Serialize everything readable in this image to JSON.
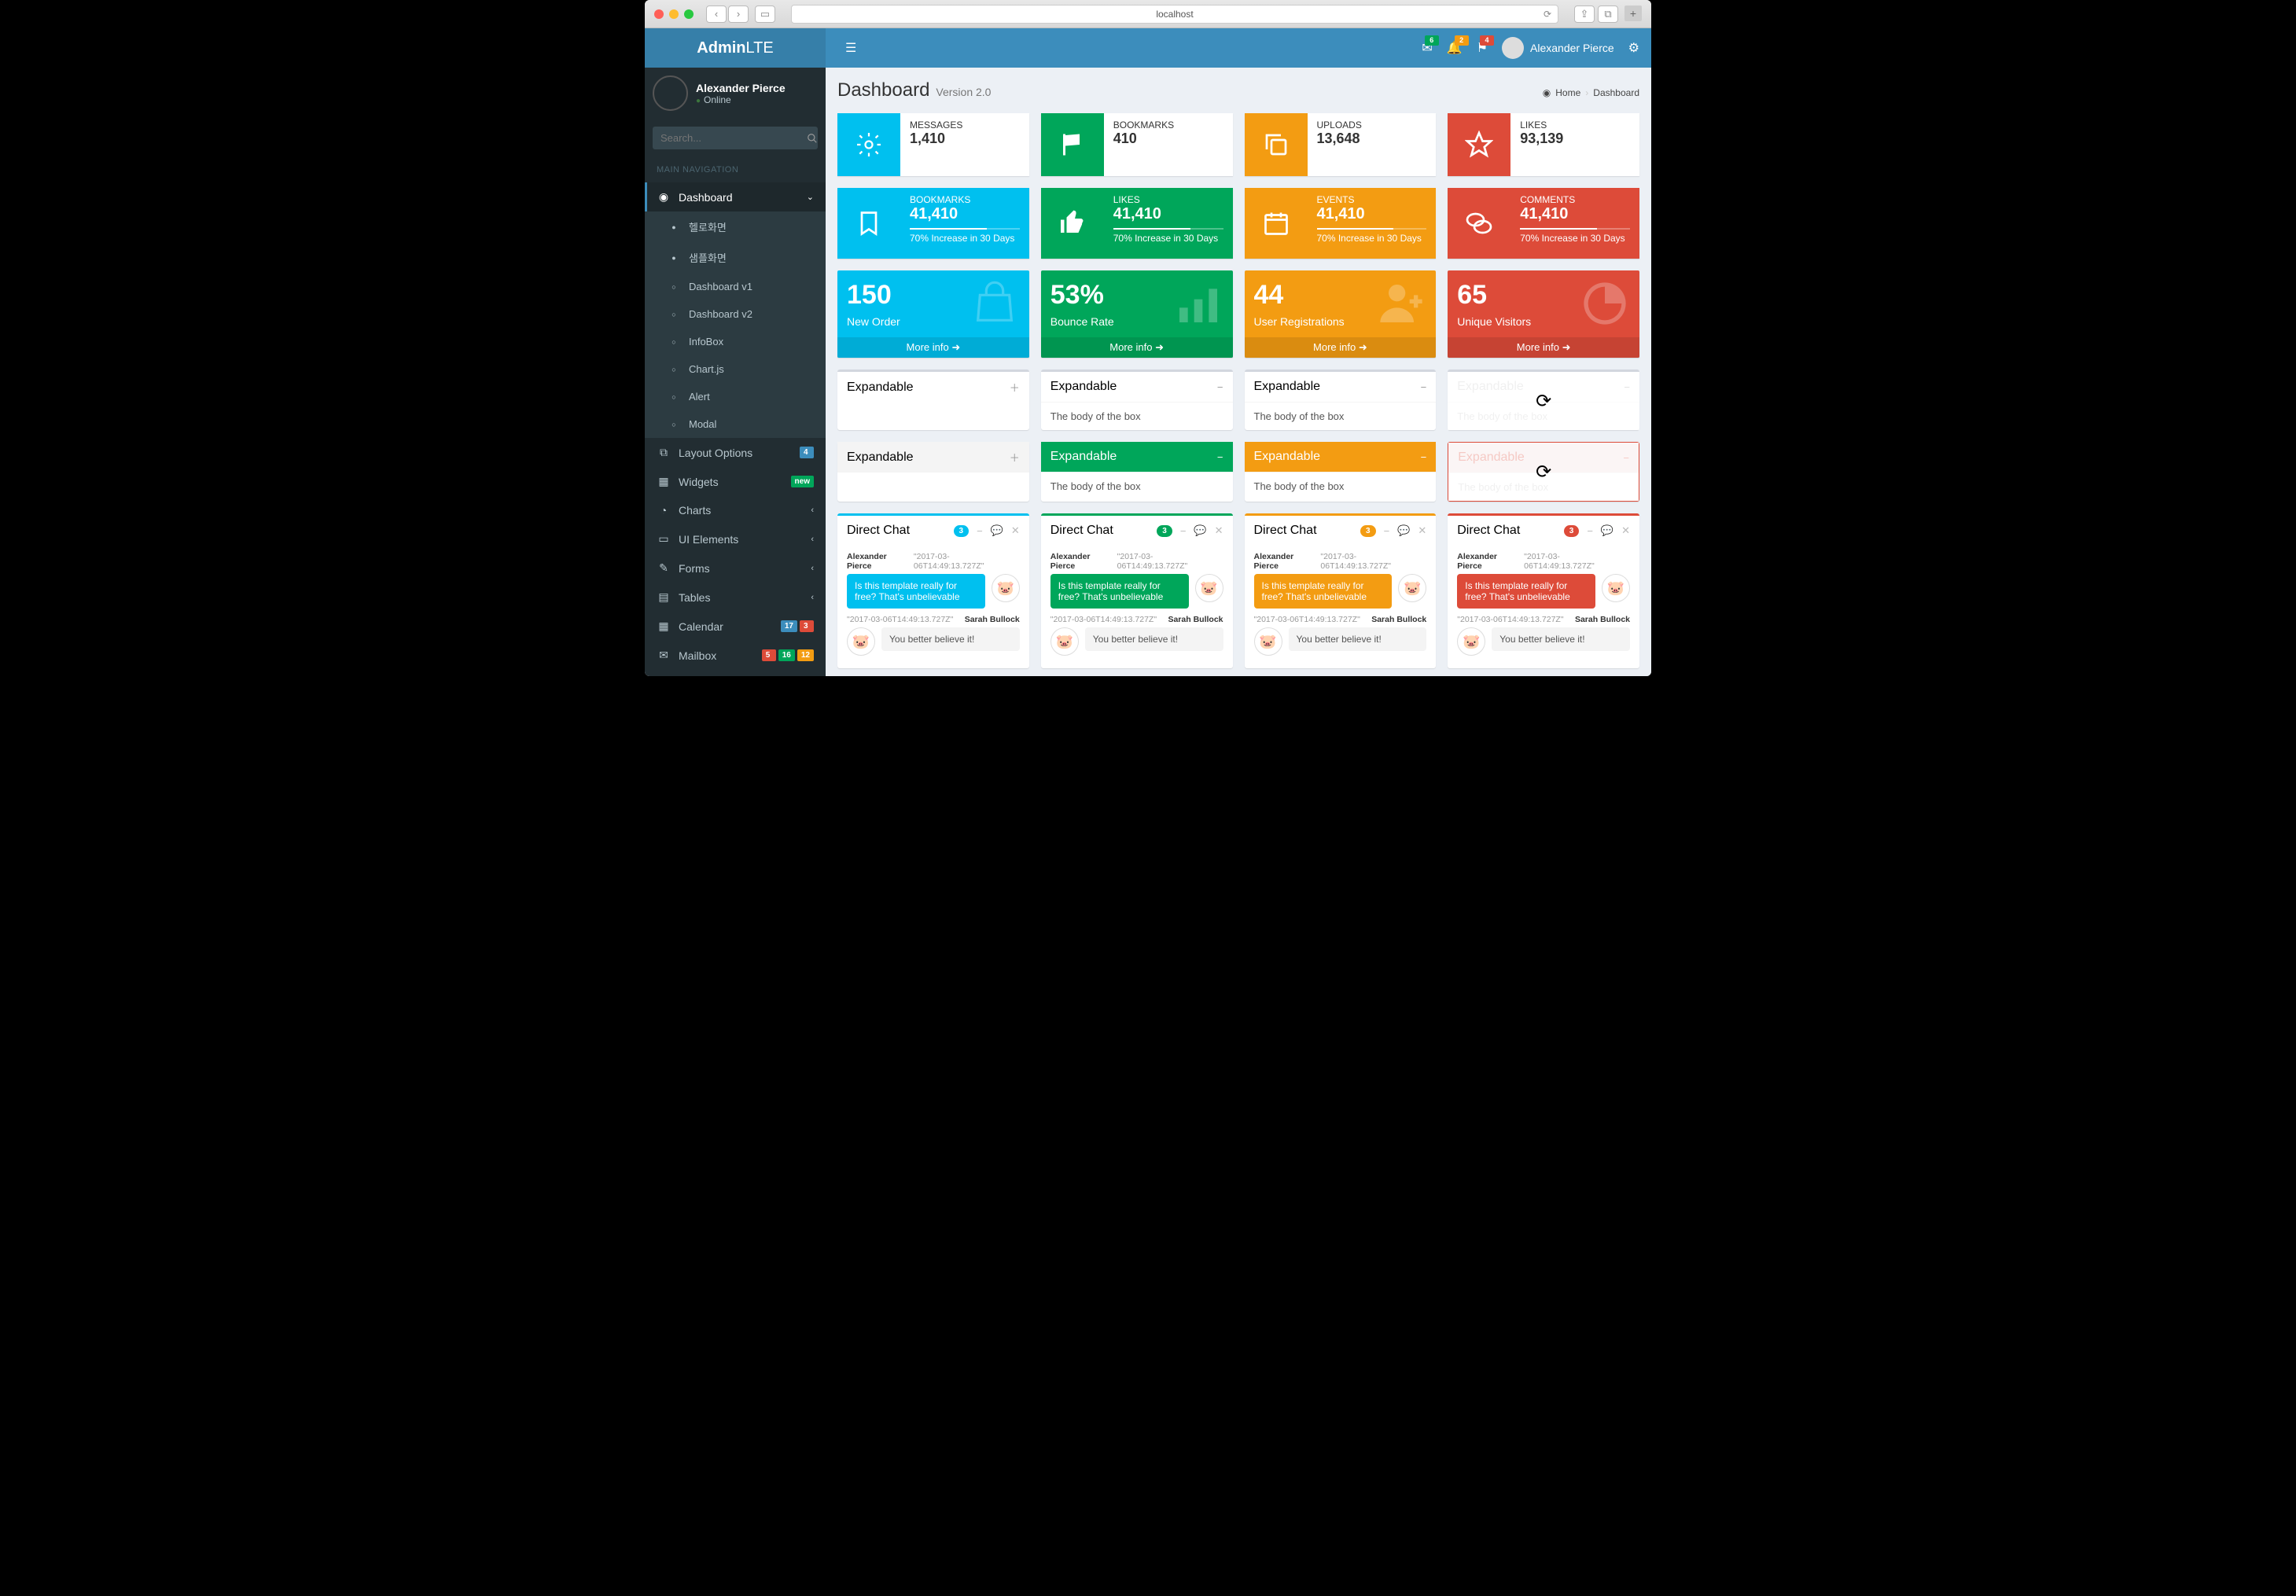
{
  "browser": {
    "url": "localhost"
  },
  "brand": {
    "bold": "Admin",
    "light": "LTE"
  },
  "user": {
    "name": "Alexander Pierce",
    "status": "Online"
  },
  "search": {
    "placeholder": "Search..."
  },
  "nav_header": "MAIN NAVIGATION",
  "sidebar": {
    "dashboard": "Dashboard",
    "sub": [
      "헬로화면",
      "샘플화면",
      "Dashboard v1",
      "Dashboard v2",
      "InfoBox",
      "Chart.js",
      "Alert",
      "Modal"
    ],
    "layout": "Layout Options",
    "layout_badge": "4",
    "widgets": "Widgets",
    "widgets_badge": "new",
    "charts": "Charts",
    "ui": "UI Elements",
    "forms": "Forms",
    "tables": "Tables",
    "calendar": "Calendar",
    "calendar_badges": [
      "17",
      "3"
    ],
    "mailbox": "Mailbox",
    "mailbox_badges": [
      "5",
      "16",
      "12"
    ]
  },
  "topbar": {
    "mail_badge": "6",
    "bell_badge": "2",
    "flag_badge": "4",
    "user": "Alexander Pierce"
  },
  "header": {
    "title": "Dashboard",
    "subtitle": "Version 2.0",
    "crumb_home": "Home",
    "crumb_page": "Dashboard"
  },
  "info1": [
    {
      "label": "MESSAGES",
      "value": "1,410",
      "color": "bg-aqua",
      "icon": "gear"
    },
    {
      "label": "BOOKMARKS",
      "value": "410",
      "color": "bg-green",
      "icon": "flag"
    },
    {
      "label": "UPLOADS",
      "value": "13,648",
      "color": "bg-yellow",
      "icon": "copy"
    },
    {
      "label": "LIKES",
      "value": "93,139",
      "color": "bg-red",
      "icon": "star"
    }
  ],
  "info2": [
    {
      "label": "BOOKMARKS",
      "value": "41,410",
      "desc": "70% Increase in 30 Days",
      "color": "bg-aqua",
      "icon": "bookmark"
    },
    {
      "label": "LIKES",
      "value": "41,410",
      "desc": "70% Increase in 30 Days",
      "color": "bg-green",
      "icon": "thumb"
    },
    {
      "label": "EVENTS",
      "value": "41,410",
      "desc": "70% Increase in 30 Days",
      "color": "bg-yellow",
      "icon": "calendar"
    },
    {
      "label": "COMMENTS",
      "value": "41,410",
      "desc": "70% Increase in 30 Days",
      "color": "bg-red",
      "icon": "comments"
    }
  ],
  "small": [
    {
      "h": "150",
      "p": "New Order",
      "color": "bg-aqua",
      "icon": "bag"
    },
    {
      "h": "53%",
      "p": "Bounce Rate",
      "color": "bg-green",
      "icon": "bars"
    },
    {
      "h": "44",
      "p": "User Registrations",
      "color": "bg-yellow",
      "icon": "person"
    },
    {
      "h": "65",
      "p": "Unique Visitors",
      "color": "bg-red",
      "icon": "pie"
    }
  ],
  "more_info": "More info",
  "expandable": {
    "title": "Expandable",
    "body": "The body of the box"
  },
  "chat": {
    "title": "Direct Chat",
    "badge": "3",
    "msg1_name": "Alexander Pierce",
    "msg1_time": "\"2017-03-06T14:49:13.727Z\"",
    "msg1_text": "Is this template really for free? That's unbelievable",
    "msg2_name": "Sarah Bullock",
    "msg2_time": "\"2017-03-06T14:49:13.727Z\"",
    "msg2_text": "You better believe it!"
  }
}
